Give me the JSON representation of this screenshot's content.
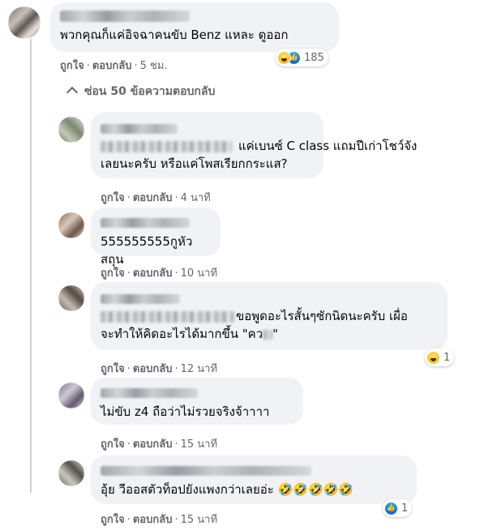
{
  "main_comment": {
    "text": "พวกคุณก็แค่อิจฉาคนขับ Benz แหละ ดูออก",
    "actions": {
      "like": "ถูกใจ",
      "reply": "ตอบกลับ",
      "time": "5 ชม."
    },
    "reaction_count": "185"
  },
  "hide_replies": {
    "icon": "chevron-up-icon",
    "label": "ซ่อน 50 ข้อความตอบกลับ"
  },
  "replies": [
    {
      "text_line1": "แค่เบนซ์ C class แถมปีเก่าโชว์จัง",
      "text_line2": "เลยนะครับ หรือแค่โพสเรียกกระแส?",
      "actions": {
        "like": "ถูกใจ",
        "reply": "ตอบกลับ",
        "time": "4 นาที"
      }
    },
    {
      "text_line1": "555555555กูหัว สถุน",
      "actions": {
        "like": "ถูกใจ",
        "reply": "ตอบกลับ",
        "time": "10 นาที"
      }
    },
    {
      "text_line1": "ขอพูดอะไรสั้นๆซักนิดนะครับ เผื่อ",
      "text_line2": "จะทำให้คิดอะไรได้มากขึ้น \"คว",
      "text_line2_end": "\"",
      "actions": {
        "like": "ถูกใจ",
        "reply": "ตอบกลับ",
        "time": "12 นาที"
      },
      "reaction_count": "1"
    },
    {
      "text_line1": "ไม่ขับ z4 ถือว่าไม่รวยจริงจ้าาาา",
      "actions": {
        "like": "ถูกใจ",
        "reply": "ตอบกลับ",
        "time": "15 นาที"
      }
    },
    {
      "text_line1": "อุ้ย วีออสตัวท็อปยังแพงกว่าเลยอ่ะ",
      "emojis": "🤣🤣🤣🤣🤣",
      "actions": {
        "like": "ถูกใจ",
        "reply": "ตอบกลับ",
        "time": "15 นาที"
      },
      "reaction_count": "1"
    }
  ],
  "separator": "·",
  "colors": {
    "bubble": "#f0f2f5",
    "meta": "#65676b",
    "text": "#050505",
    "like_blue": "#1877f2"
  }
}
